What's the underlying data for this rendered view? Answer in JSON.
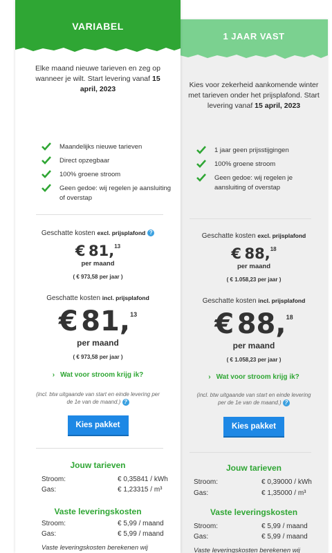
{
  "left": {
    "header": "VARIABEL",
    "intro_text": "Elke maand nieuwe tarieven en zeg op wanneer je wilt. Start levering vanaf ",
    "intro_date": "15 april, 2023",
    "features": [
      "Maandelijks nieuwe tarieven",
      "Direct opzegbaar",
      "100% groene stroom",
      "Geen gedoe: wij regelen je aansluiting of overstap"
    ],
    "cost_label_excl": "Geschatte kosten ",
    "cost_label_excl_bold": "excl. prijsplafond",
    "price_excl_int": "81,",
    "price_excl_dec": "13",
    "per_month": "per maand",
    "per_year_excl": "( € 973,58 per jaar )",
    "cost_label_incl": "Geschatte kosten ",
    "cost_label_incl_bold": "incl. prijsplafond",
    "price_incl_int": "81,",
    "price_incl_dec": "13",
    "per_year_incl": "( € 973,58 per jaar )",
    "link": "Wat voor stroom krijg ik?",
    "fine_print": "(incl. btw uitgaande van start en einde levering per de 1e van de maand.)",
    "button": "Kies pakket",
    "tarieven_title": "Jouw tarieven",
    "stroom_label": "Stroom:",
    "stroom_value": "€ 0,35841 / kWh",
    "gas_label": "Gas:",
    "gas_value": "€ 1,23315 / m³",
    "vaste_title": "Vaste leveringskosten",
    "vaste_stroom_label": "Stroom:",
    "vaste_stroom_value": "€ 5,99 / maand",
    "vaste_gas_label": "Gas:",
    "vaste_gas_value": "€ 5,99 / maand",
    "footer_note": "Vaste leveringskosten berekenen wij"
  },
  "right": {
    "header": "1 JAAR VAST",
    "intro_text": "Kies voor zekerheid aankomende winter met tarieven onder het prijsplafond. Start levering vanaf ",
    "intro_date": "15 april, 2023",
    "features": [
      "1 jaar geen prijsstijgingen",
      "100% groene stroom",
      "Geen gedoe: wij regelen je aansluiting of overstap"
    ],
    "cost_label_excl": "Geschatte kosten ",
    "cost_label_excl_bold": "excl. prijsplafond",
    "price_excl_int": "88,",
    "price_excl_dec": "18",
    "per_month": "per maand",
    "per_year_excl": "( € 1.058,23 per jaar )",
    "cost_label_incl": "Geschatte kosten ",
    "cost_label_incl_bold": "incl. prijsplafond",
    "price_incl_int": "88,",
    "price_incl_dec": "18",
    "per_year_incl": "( € 1.058,23 per jaar )",
    "link": "Wat voor stroom krijg ik?",
    "fine_print": "(incl. btw uitgaande van start en einde levering per de 1e van de maand.)",
    "button": "Kies pakket",
    "tarieven_title": "Jouw tarieven",
    "stroom_label": "Stroom:",
    "stroom_value": "€ 0,39000 / kWh",
    "gas_label": "Gas:",
    "gas_value": "€ 1,35000 / m³",
    "vaste_title": "Vaste leveringskosten",
    "vaste_stroom_label": "Stroom:",
    "vaste_stroom_value": "€ 5,99 / maand",
    "vaste_gas_label": "Gas:",
    "vaste_gas_value": "€ 5,99 / maand",
    "footer_note": "Vaste leveringskosten berekenen wij"
  },
  "currency": "€",
  "info_icon": "?",
  "link_chevron": "›",
  "colors": {
    "green": "#2fa634",
    "light_green": "#7bd190",
    "blue_button": "#1e88e5",
    "info_blue": "#3aa0e0"
  }
}
